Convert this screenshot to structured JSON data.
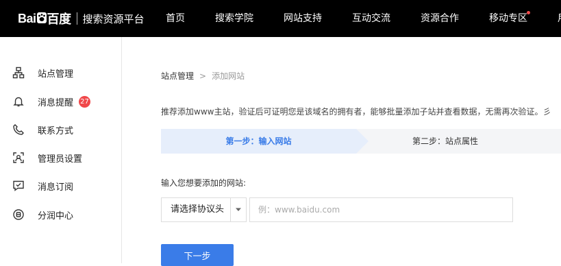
{
  "header": {
    "brand_left": "Bai",
    "brand_right": "百度",
    "platform": "搜索资源平台",
    "nav": [
      {
        "label": "首页"
      },
      {
        "label": "搜索学院"
      },
      {
        "label": "网站支持"
      },
      {
        "label": "互动交流"
      },
      {
        "label": "资源合作"
      },
      {
        "label": "移动专区",
        "dot": true
      },
      {
        "label": "用"
      }
    ],
    "dot_color": "#f04b4b"
  },
  "sidebar": {
    "items": [
      {
        "label": "站点管理",
        "icon": "sitemap-icon"
      },
      {
        "label": "消息提醒",
        "icon": "bell-icon",
        "badge": "27"
      },
      {
        "label": "联系方式",
        "icon": "phone-icon"
      },
      {
        "label": "管理员设置",
        "icon": "admin-icon"
      },
      {
        "label": "消息订阅",
        "icon": "subscribe-icon"
      },
      {
        "label": "分润中心",
        "icon": "revenue-icon"
      }
    ]
  },
  "main": {
    "breadcrumb": {
      "parent": "站点管理",
      "separator": ">",
      "current": "添加网站"
    },
    "intro": "推荐添加www主站，验证后可证明您是该域名的拥有者，能够批量添加子站并查看数据，无需再次验证。彡",
    "steps": [
      {
        "label": "第一步：输入网站",
        "active": true
      },
      {
        "label": "第二步：站点属性",
        "active": false
      }
    ],
    "field_label": "输入您想要添加的网站:",
    "protocol_select": {
      "value": "请选择协议头"
    },
    "url_input": {
      "value": "",
      "placeholder": "例：www.baidu.com"
    },
    "next_button": "下一步"
  },
  "colors": {
    "accent": "#3a7ce8",
    "badge": "#f0484a",
    "topbar": "#000000"
  }
}
